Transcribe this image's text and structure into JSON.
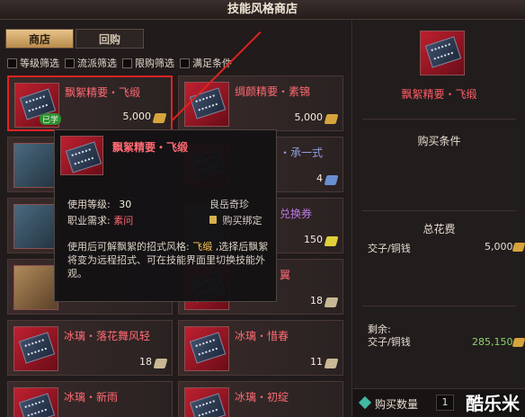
{
  "window": {
    "title": "技能风格商店"
  },
  "tabs": [
    {
      "label": "商店",
      "active": true
    },
    {
      "label": "回购",
      "active": false
    }
  ],
  "filters": [
    {
      "label": "等级筛选"
    },
    {
      "label": "流派筛选"
    },
    {
      "label": "限购筛选"
    },
    {
      "label": "满足条件"
    }
  ],
  "items": [
    {
      "name": "飘絮精要・飞缎",
      "price": "5,000",
      "badge": "已学"
    },
    {
      "name": "绸颜精要・素锦",
      "price": "5,000"
    },
    {
      "name": "・承一式",
      "price": "4"
    },
    {
      "name": "兑换券",
      "price": "150"
    },
    {
      "name": "翼",
      "price": "18"
    },
    {
      "name": "冰璃・落花舞风轻",
      "price": "18"
    },
    {
      "name": "冰璃・惜春",
      "price": "11"
    },
    {
      "name": "冰璃・新雨",
      "price": ""
    },
    {
      "name": "冰璃・初绽",
      "price": ""
    }
  ],
  "tooltip": {
    "title": "飘絮精要・飞缎",
    "level_label": "使用等级:",
    "level_value": "30",
    "job_label": "职业需求:",
    "job_value": "素问",
    "quality": "良岳奇珍",
    "bind": "购买绑定",
    "desc_prefix": "使用后可解飘絮的招式风格:",
    "desc_highlight": "飞缎",
    "desc_suffix": ",选择后飘絮将变为远程招式、可在技能界面里切换技能外观。"
  },
  "detail": {
    "name": "飘絮精要・飞缎",
    "purchase_conditions_label": "购买条件",
    "total_cost_label": "总花费",
    "cost_currency_label": "交子/铜钱",
    "cost_value": "5,000",
    "remaining_label": "剩余:",
    "remaining_currency_label": "交子/铜钱",
    "remaining_value": "285,150",
    "quantity_label": "购买数量",
    "quantity_value": "1"
  },
  "watermark": "酷乐米",
  "colors": {
    "accent_red": "#e02222",
    "item_name": "#ff6a72",
    "gold": "#d6a43c"
  }
}
